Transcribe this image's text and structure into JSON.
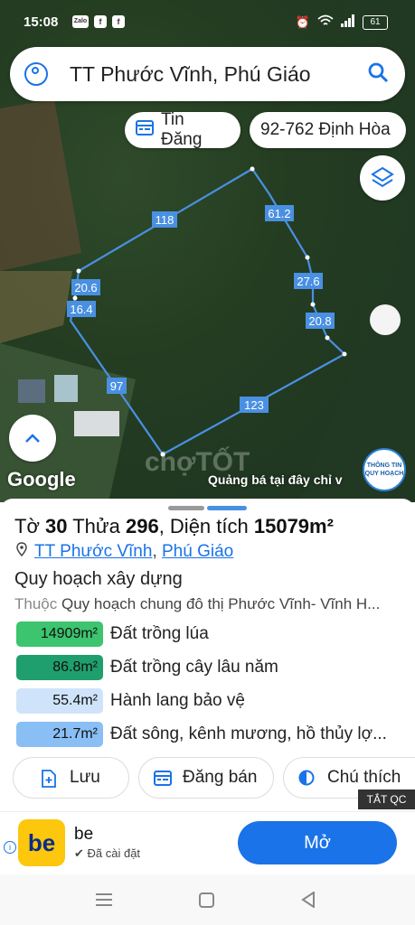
{
  "status_bar": {
    "time": "15:08",
    "battery": "61",
    "left_icons": [
      "Zalo",
      "f",
      "f"
    ]
  },
  "search": {
    "query": "TT Phước Vĩnh, Phú Giáo"
  },
  "chips": {
    "tin_dang": "Tin Đăng",
    "dinh_hoa": "92-762 Định Hòa"
  },
  "map": {
    "edge_labels": [
      "118",
      "61.2",
      "27.6",
      "20.8",
      "123",
      "97",
      "16.4",
      "20.6"
    ],
    "google": "Google",
    "ad_text": "Quảng bá tại đây chỉ v",
    "watermark": "chợTỐT",
    "qh_badge": "THÔNG TIN QUY HOẠCH"
  },
  "sheet": {
    "title_to_label": "Tờ",
    "title_to": "30",
    "title_thua_label": "Thửa",
    "title_thua": "296",
    "title_area_label": ", Diện tích",
    "title_area": "15079m²",
    "addr_1": "TT Phước Vĩnh",
    "addr_2": "Phú Giáo",
    "section": "Quy hoạch xây dựng",
    "belongs_key": "Thuộc",
    "belongs_value": "Quy hoạch chung đô thị Phước Vĩnh- Vĩnh H...",
    "zones": [
      {
        "area": "14909m²",
        "label": "Đất trồng lúa",
        "color": "#3cc46e"
      },
      {
        "area": "86.8m²",
        "label": "Đất trồng cây lâu năm",
        "color": "#1f9f6d"
      },
      {
        "area": "55.4m²",
        "label": "Hành lang bảo vệ",
        "color": "#cfe4fb"
      },
      {
        "area": "21.7m²",
        "label": "Đất sông, kênh mương, hồ thủy lợ...",
        "color": "#89bff5"
      }
    ],
    "buttons": {
      "save": "Lưu",
      "post": "Đăng bán",
      "legend": "Chú thích"
    }
  },
  "ad": {
    "close": "TẮT QC",
    "app_name": "be",
    "installed": "Đã cài đặt",
    "open": "Mở",
    "logo": "be"
  }
}
